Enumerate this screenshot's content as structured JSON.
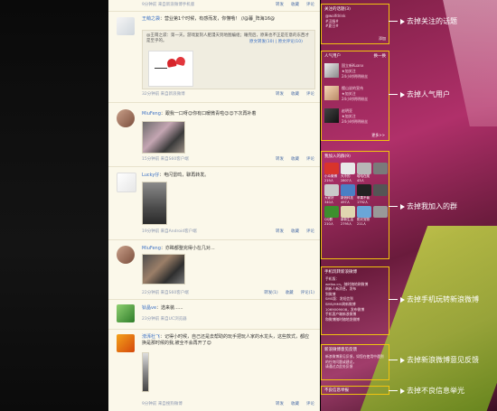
{
  "feed": {
    "posts": [
      {
        "name": "王萌之袋",
        "text": "：营业第1个时候，有感而发，你懂哦！ //@暮_阵海16@",
        "forward": {
          "text": "@王萌之袋：第一天，游戏复刻人肥漫天到地图编组；睡完后，原来也不正是在意的东西才是至乎的。",
          "forwards": "原文转发(10)",
          "comments": "原文评论(10)"
        },
        "time": "32分钟前",
        "source": "来自新浪微博",
        "actions": [
          "转发",
          "收藏",
          "评论"
        ]
      },
      {
        "name": "MiuFeng",
        "text": "：跟我一口呀😉你有口暖微青啦😉😉下次再补着",
        "time": "15分钟前",
        "source": "来自S60客户端",
        "actions": [
          "转发",
          "收藏",
          "评论"
        ]
      },
      {
        "name": "Lucky仔",
        "text": "：电闪雷鸣，聊再转发。",
        "time": "19分钟前",
        "source": "来自Android客户端",
        "actions": [
          "转发",
          "收藏",
          "评论"
        ]
      },
      {
        "name": "MiuFeng",
        "text": "：亦眸都整完得小在几对...",
        "time": "22分钟前",
        "source": "来自S60客户端",
        "actions": [
          "转发(1)",
          "收藏",
          "评论(1)"
        ]
      },
      {
        "name": "钬晶ve",
        "text": "：选来装......",
        "time": "23分钟前",
        "source": "来自UC浏览器",
        "actions": [
          "转发",
          "收藏",
          "评论"
        ]
      },
      {
        "name": "滂湃杜飞",
        "text": "：记得小时候，自己还是去帮助的玩手把玩人家的水龙头，这些款式，都应换是那时候的我,被全不会再开了😊",
        "time": "9分钟前",
        "source": "来自搜狗微博",
        "actions": [
          "转发",
          "收藏",
          "评论"
        ]
      }
    ]
  },
  "sidebar": {
    "topics": {
      "title": "关注的话题(3)",
      "items": [
        "@wolfdrink",
        "#汉服#",
        "#夏日#"
      ],
      "more": "添加"
    },
    "hot_users": {
      "title": "人气用户",
      "more": "换一换",
      "users": [
        {
          "name": "国立新Kuanx",
          "meta": "★加关注",
          "fans": "24小时明明粉丝"
        },
        {
          "name": "樱山说的宣伟",
          "meta": "★加关注",
          "fans": "24小时明明粉丝"
        },
        {
          "name": "赵明亚",
          "meta": "★加关注",
          "fans": "24小时明明粉丝"
        }
      ],
      "footer": "更多>>"
    },
    "groups": {
      "title": "我加入的群(9)",
      "items": [
        {
          "label": "小众微博",
          "count": "219人",
          "color": "#d9342b"
        },
        {
          "label": "大冷的",
          "count": "2807人",
          "color": "#e8e8e8"
        },
        {
          "label": "哈哈在爬",
          "count": "43人",
          "color": "#b7b7b7"
        },
        {
          "label": "",
          "count": "",
          "color": "#7a7a7a"
        },
        {
          "label": "大家好",
          "count": "340人",
          "color": "#c9c9c9"
        },
        {
          "label": "新浪科技",
          "count": "497人",
          "color": "#4a7fc4"
        },
        {
          "label": "苹果不偷",
          "count": "1792人",
          "color": "#222222"
        },
        {
          "label": "",
          "count": "",
          "color": "#555555"
        },
        {
          "label": "QQ群",
          "count": "210人",
          "color": "#3d8f2e"
        },
        {
          "label": "新新生活",
          "count": "2795人",
          "color": "#e0d6b0"
        },
        {
          "label": "阳光宠物",
          "count": "211人",
          "color": "#6aa6d8"
        },
        {
          "label": "",
          "count": "",
          "color": "#999999"
        }
      ]
    },
    "mobile": {
      "title": "手机玩转新浪微博",
      "lines": [
        "手机版：",
        "weibo.cn，随时随地刷微博",
        "刷新人新消息，发布",
        "到微博",
        "SMS版：发短信到",
        "SMS/MMS刷新微博",
        "1069009008，发布微博",
        "手机客户端新浪微博",
        "和微博随时随地发微博"
      ]
    },
    "feedback": {
      "title": "新浪微博意见反馈",
      "lines": [
        "新浪微博意见反馈，如您在使用中遇到",
        "的任何问题或建议，",
        "请通过点此处反馈"
      ]
    },
    "report": {
      "label": "不良信息举报"
    }
  },
  "callouts": [
    "去掉关注的话题",
    "去掉人气用户",
    "去掉我加入的群",
    "去掉手机玩转新浪微博",
    "去掉新浪微博意见反馈",
    "去掉不良信息举光"
  ],
  "colors": {
    "highlight": "#f1c40f",
    "feed_bg": "#fbf8ea",
    "link": "#3a6fc4"
  }
}
